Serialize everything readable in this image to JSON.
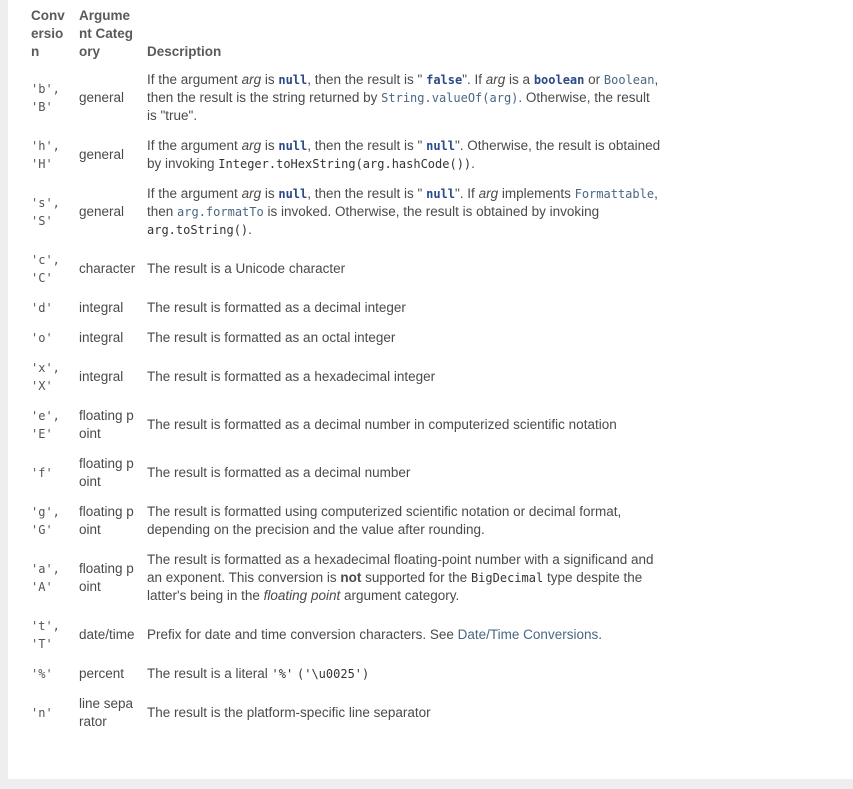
{
  "headers": {
    "conversion": "Conversion",
    "category": "Argument Category",
    "description": "Description"
  },
  "rows": [
    {
      "conv": "'b', 'B'",
      "cat": "general",
      "d": {
        "p1": "If the argument ",
        "arg": "arg",
        "p2": " is ",
        "null": "null",
        "p3": ", then the result is \" ",
        "false": "false",
        "p4": "\". If ",
        "arg2": "arg",
        "p5": " is a ",
        "boolean": "boolean",
        "p6": " or ",
        "Boolean": "Boolean",
        "p7": ", then the result is the string returned by ",
        "valueOf": "String.valueOf(arg)",
        "p8": ". Otherwise, the result is \"true\"."
      }
    },
    {
      "conv": "'h', 'H'",
      "cat": "general",
      "d": {
        "p1": "If the argument ",
        "arg": "arg",
        "p2": " is ",
        "null": "null",
        "p3": ", then the result is \" ",
        "nullv": "null",
        "p4": "\". Otherwise, the result is obtained by invoking ",
        "code": "Integer.toHexString(arg.hashCode())",
        "p5": "."
      }
    },
    {
      "conv": "'s', 'S'",
      "cat": "general",
      "d": {
        "p1": "If the argument ",
        "arg": "arg",
        "p2": " is ",
        "null": "null",
        "p3": ", then the result is \" ",
        "nullv": "null",
        "p4": "\". If ",
        "arg2": "arg",
        "p5": " implements ",
        "formattable": "Formattable",
        "p6": ", then ",
        "formatTo": "arg.formatTo",
        "p7": " is invoked. Otherwise, the result is obtained by invoking ",
        "toString": "arg.toString()",
        "p8": "."
      }
    },
    {
      "conv": "'c', 'C'",
      "cat": "character",
      "desc": "The result is a Unicode character"
    },
    {
      "conv": "'d'",
      "cat": "integral",
      "desc": "The result is formatted as a decimal integer"
    },
    {
      "conv": "'o'",
      "cat": "integral",
      "desc": "The result is formatted as an octal integer"
    },
    {
      "conv": "'x', 'X'",
      "cat": "integral",
      "desc": "The result is formatted as a hexadecimal integer"
    },
    {
      "conv": "'e', 'E'",
      "cat": "floating point",
      "desc": "The result is formatted as a decimal number in computerized scientific notation"
    },
    {
      "conv": "'f'",
      "cat": "floating point",
      "desc": "The result is formatted as a decimal number"
    },
    {
      "conv": "'g', 'G'",
      "cat": "floating point",
      "desc": "The result is formatted using computerized scientific notation or decimal format, depending on the precision and the value after rounding."
    },
    {
      "conv": "'a', 'A'",
      "cat": "floating point",
      "d": {
        "p1": "The result is formatted as a hexadecimal floating-point number with a significand and an exponent. This conversion is ",
        "not": "not",
        "p2": " supported for the ",
        "bigdecimal": "BigDecimal",
        "p3": " type despite the latter's being in the ",
        "fp": "floating point",
        "p4": " argument category."
      }
    },
    {
      "conv": "'t', 'T'",
      "cat": "date/time",
      "d": {
        "p1": "Prefix for date and time conversion characters. See ",
        "link": "Date/Time Conversions",
        "p2": "."
      }
    },
    {
      "conv": "'%'",
      "cat": "percent",
      "d": {
        "p1": "The result is a literal ",
        "lit": "'%'",
        "p2": " ",
        "u": "('\\u0025')"
      }
    },
    {
      "conv": "'n'",
      "cat": "line separator",
      "desc": "The result is the platform-specific line separator"
    }
  ]
}
